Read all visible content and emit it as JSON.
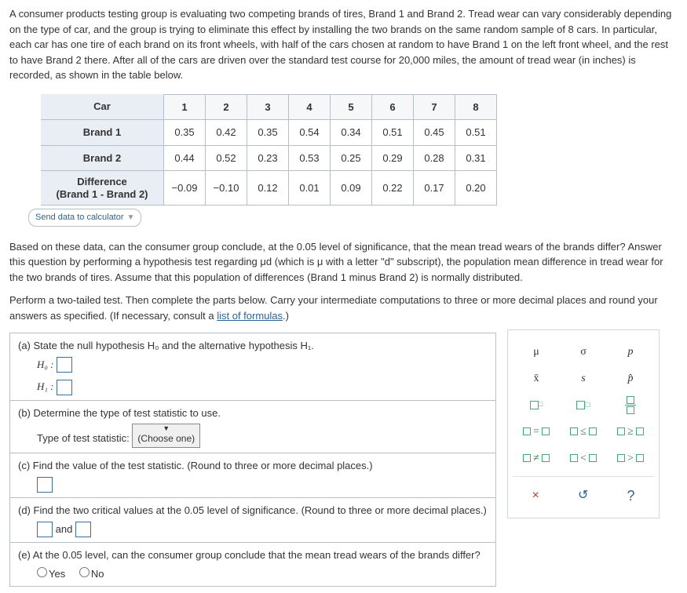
{
  "intro_text": "A consumer products testing group is evaluating two competing brands of tires, Brand 1 and Brand 2. Tread wear can vary considerably depending on the type of car, and the group is trying to eliminate this effect by installing the two brands on the same random sample of 8 cars. In particular, each car has one tire of each brand on its front wheels, with half of the cars chosen at random to have Brand 1 on the left front wheel, and the rest to have Brand 2 there. After all of the cars are driven over the standard test course for 20,000 miles, the amount of tread wear (in inches) is recorded, as shown in the table below.",
  "table": {
    "row_hdr_car": "Car",
    "cars": [
      "1",
      "2",
      "3",
      "4",
      "5",
      "6",
      "7",
      "8"
    ],
    "row_hdr_b1": "Brand 1",
    "b1": [
      "0.35",
      "0.42",
      "0.35",
      "0.54",
      "0.34",
      "0.51",
      "0.45",
      "0.51"
    ],
    "row_hdr_b2": "Brand 2",
    "b2": [
      "0.44",
      "0.52",
      "0.23",
      "0.53",
      "0.25",
      "0.29",
      "0.28",
      "0.31"
    ],
    "row_hdr_diff_a": "Difference",
    "row_hdr_diff_b": "(Brand 1 - Brand 2)",
    "diff": [
      "−0.09",
      "−0.10",
      "0.12",
      "0.01",
      "0.09",
      "0.22",
      "0.17",
      "0.20"
    ]
  },
  "send_link": "Send data to calculator",
  "middle_p1": "Based on these data, can the consumer group conclude, at the 0.05 level of significance, that the mean tread wears of the brands differ? Answer this question by performing a hypothesis test regarding μd (which is μ with a letter \"d\" subscript), the population mean difference in tread wear for the two brands of tires. Assume that this population of differences (Brand 1 minus Brand 2) is normally distributed.",
  "middle_p2_a": "Perform a two-tailed test. Then complete the parts below. Carry your intermediate computations to three or more decimal places and round your answers as specified. (If necessary, consult a ",
  "middle_p2_link": "list of formulas",
  "middle_p2_b": ".)",
  "q": {
    "a_text": "(a)  State the null hypothesis H₀ and the alternative hypothesis H₁.",
    "h0_label": "H₀ :",
    "h1_label": "H₁ :",
    "b_text": "(b)  Determine the type of test statistic to use.",
    "b_label": "Type of test statistic:",
    "b_select": "(Choose one)",
    "c_text": "(c)  Find the value of the test statistic. (Round to three or more decimal places.)",
    "d_text": "(d)  Find the two critical values at the 0.05 level of significance. (Round to three or more decimal places.)",
    "d_and": "and",
    "e_text": "(e)  At the 0.05 level, can the consumer group conclude that the mean tread wears of the brands differ?",
    "e_yes": "Yes",
    "e_no": "No"
  },
  "pal": {
    "mu": "μ",
    "sigma": "σ",
    "p": "p",
    "xbar": "x̄",
    "s": "s",
    "phat": "p̂",
    "eq": "=",
    "le": "≤",
    "ge": "≥",
    "ne": "≠",
    "lt": "<",
    "gt": ">",
    "x": "×",
    "reset": "↺",
    "help": "?"
  }
}
